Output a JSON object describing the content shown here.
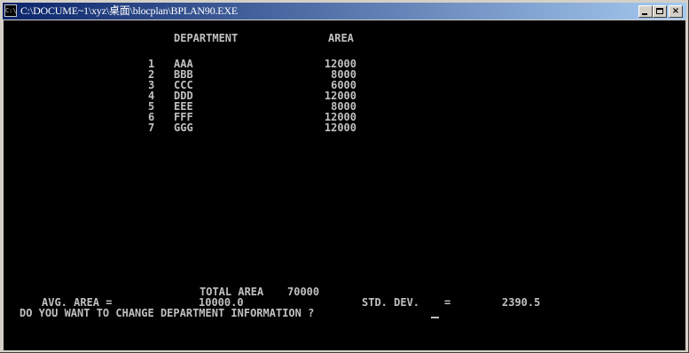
{
  "window": {
    "title": "C:\\DOCUME~1\\xyz\\桌面\\blocplan\\BPLAN90.EXE",
    "icon_label": "C:\\",
    "buttons": {
      "minimize": "minimize-icon",
      "maximize": "maximize-icon",
      "close": "×"
    }
  },
  "console": {
    "header": {
      "department": "DEPARTMENT",
      "area": "AREA"
    },
    "rows": [
      {
        "num": "1",
        "name": "AAA",
        "area": "12000"
      },
      {
        "num": "2",
        "name": "BBB",
        "area": "8000"
      },
      {
        "num": "3",
        "name": "CCC",
        "area": "6000"
      },
      {
        "num": "4",
        "name": "DDD",
        "area": "12000"
      },
      {
        "num": "5",
        "name": "EEE",
        "area": "8000"
      },
      {
        "num": "6",
        "name": "FFF",
        "area": "12000"
      },
      {
        "num": "7",
        "name": "GGG",
        "area": "12000"
      }
    ],
    "total_area_label": "TOTAL AREA",
    "total_area_value": "70000",
    "avg_area_label": "AVG. AREA =",
    "avg_area_value": "10000.0",
    "std_dev_label": "STD. DEV.",
    "std_dev_eq": "=",
    "std_dev_value": "2390.5",
    "prompt": "DO YOU WANT TO CHANGE DEPARTMENT INFORMATION ?"
  },
  "colors": {
    "console_bg": "#000000",
    "console_fg": "#c0c0c0",
    "titlebar_start": "#0a246a",
    "titlebar_end": "#a6caf0"
  }
}
